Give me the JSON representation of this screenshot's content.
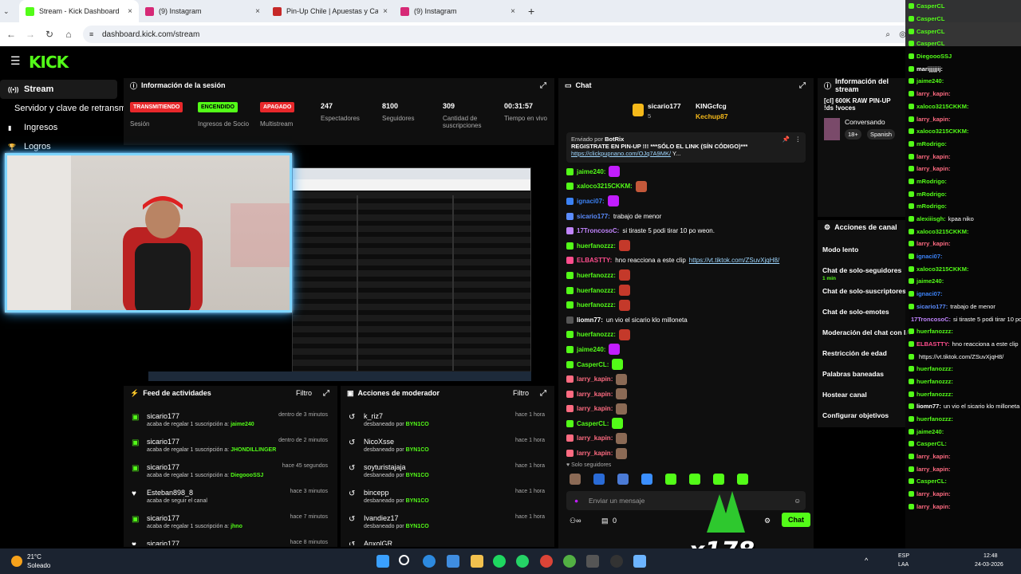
{
  "browser": {
    "tabs": [
      {
        "label": "Stream - Kick Dashboard",
        "color": "#53fc18"
      },
      {
        "label": "(9) Instagram",
        "color": "#d62976"
      },
      {
        "label": "Pin-Up Chile | Apuestas y Casin",
        "color": "#c62828"
      },
      {
        "label": "(9) Instagram",
        "color": "#d62976"
      }
    ],
    "url": "dashboard.kick.com/stream"
  },
  "header": {
    "logo": "KICK"
  },
  "sidebar": [
    {
      "label": "Stream",
      "icon": "radio-icon"
    },
    {
      "label": "Servidor y clave de retransm",
      "icon": "key-icon"
    },
    {
      "label": "Ingresos",
      "icon": "chart-icon"
    },
    {
      "label": "Logros",
      "icon": "trophy-icon"
    }
  ],
  "session": {
    "title": "Información de la sesión",
    "items": [
      {
        "pill": "TRANSMITIENDO",
        "pill_color": "#e8282b",
        "label": "Sesión"
      },
      {
        "pill": "ENCENDIDO",
        "pill_color": "#53fc18",
        "label": "Ingresos de Socio"
      },
      {
        "pill": "APAGADO",
        "pill_color": "#e8282b",
        "label": "Multistream"
      },
      {
        "value": "247",
        "label": "Espectadores"
      },
      {
        "value": "8100",
        "label": "Seguidores"
      },
      {
        "value": "309",
        "label": "Cantidad de suscripciones"
      },
      {
        "value": "00:31:57",
        "label": "Tiempo en vivo"
      }
    ]
  },
  "feed": {
    "title": "Feed de actividades",
    "filter": "Filtro",
    "rows": [
      {
        "name": "sicario177",
        "pre": "acaba de regalar 1 suscripción a:",
        "target": "jaime240",
        "time": "dentro de 3 minutos"
      },
      {
        "name": "sicario177",
        "pre": "acaba de regalar 1 suscripción a:",
        "target": "JHONDILLINGER",
        "time": "dentro de 2 minutos"
      },
      {
        "name": "sicario177",
        "pre": "acaba de regalar 1 suscripción a:",
        "target": "DiegoooSSJ",
        "time": "hace 45 segundos"
      },
      {
        "name": "Esteban898_8",
        "pre": "acaba de seguir el canal",
        "target": "",
        "time": "hace 3 minutos"
      },
      {
        "name": "sicario177",
        "pre": "acaba de regalar 1 suscripción a:",
        "target": "jhno",
        "time": "hace 7 minutos"
      },
      {
        "name": "sicario177",
        "pre": "",
        "target": "",
        "time": "hace 8 minutos"
      }
    ]
  },
  "mod": {
    "title": "Acciones de moderador",
    "filter": "Filtro",
    "rows": [
      {
        "name": "k_riz7",
        "action": "desbaneado por",
        "by": "BYN1CO",
        "time": "hace 1 hora"
      },
      {
        "name": "NicoXsse",
        "action": "desbaneado por",
        "by": "BYN1CO",
        "time": "hace 1 hora"
      },
      {
        "name": "soyturistajaja",
        "action": "desbaneado por",
        "by": "BYN1CO",
        "time": "hace 1 hora"
      },
      {
        "name": "bincepp",
        "action": "desbaneado por",
        "by": "BYN1CO",
        "time": "hace 1 hora"
      },
      {
        "name": "Ivandiez17",
        "action": "desbaneado por",
        "by": "BYN1CO",
        "time": "hace 1 hora"
      },
      {
        "name": "AnxolGR",
        "action": "",
        "by": "",
        "time": ""
      }
    ]
  },
  "chat": {
    "title": "Chat",
    "top": {
      "user1": "sicario177",
      "count": "5",
      "user2": "KINGcfcg",
      "user3": "Kechup87"
    },
    "pinned": {
      "by": "Enviado por",
      "bot": "BotRix",
      "text": "REGISTRATE EN PIN-UP",
      "text2": "!!! ***SÓLO EL LINK (SÍN CÓDIGO)***",
      "link": "https://clickpupnano.com/OJq7A9MK/",
      "tail": "Y..."
    },
    "messages": [
      {
        "user": "jaime240:",
        "color": "#53fc18",
        "text": "",
        "emote": "#c21dff"
      },
      {
        "user": "xaloco3215CKKM:",
        "color": "#53fc18",
        "text": "",
        "emote": "#c4583a"
      },
      {
        "user": "ignaci07:",
        "color": "#3b82f6",
        "text": "",
        "emote": "#c21dff"
      },
      {
        "user": "sicario177:",
        "color": "#5b8cff",
        "text": "trabajo de menor",
        "emote": ""
      },
      {
        "user": "17TroncosoC:",
        "color": "#c084fc",
        "text": "si tiraste 5 podi tirar 10 po weon.",
        "emote": ""
      },
      {
        "user": "huerfanozzz:",
        "color": "#53fc18",
        "text": "",
        "emote": "#c4392a"
      },
      {
        "user": "ELBASTTY:",
        "color": "#ff4d8d",
        "text": "hno reacciona a este clip",
        "link": "https://vt.tiktok.com/ZSuvXjqH8/",
        "emote": ""
      },
      {
        "user": "huerfanozzz:",
        "color": "#53fc18",
        "text": "",
        "emote": "#c4392a"
      },
      {
        "user": "huerfanozzz:",
        "color": "#53fc18",
        "text": "",
        "emote": "#c4392a"
      },
      {
        "user": "huerfanozzz:",
        "color": "#53fc18",
        "text": "",
        "emote": "#c4392a"
      },
      {
        "user": "liomn77:",
        "color": "#ffffff",
        "text": "un vio el sicario klo milloneta",
        "emote": ""
      },
      {
        "user": "huerfanozzz:",
        "color": "#53fc18",
        "text": "",
        "emote": "#c4392a"
      },
      {
        "user": "jaime240:",
        "color": "#53fc18",
        "text": "",
        "emote": "#c21dff"
      },
      {
        "user": "CasperCL:",
        "color": "#53fc18",
        "text": "",
        "emote": "#53fc18"
      },
      {
        "user": "larry_kapin:",
        "color": "#ff6b81",
        "text": "",
        "emote": "#8b6a55"
      },
      {
        "user": "larry_kapin:",
        "color": "#ff6b81",
        "text": "",
        "emote": "#8b6a55"
      },
      {
        "user": "larry_kapin:",
        "color": "#ff6b81",
        "text": "",
        "emote": "#8b6a55"
      },
      {
        "user": "CasperCL:",
        "color": "#53fc18",
        "text": "",
        "emote": "#53fc18"
      },
      {
        "user": "larry_kapin:",
        "color": "#ff6b81",
        "text": "",
        "emote": "#8b6a55"
      },
      {
        "user": "larry_kapin:",
        "color": "#ff6b81",
        "text": "",
        "emote": "#8b6a55"
      }
    ],
    "mode": "Solo seguidores",
    "placeholder": "Enviar un mensaje",
    "count": "0",
    "send": "Chat"
  },
  "streaminfo": {
    "title": "Información del stream",
    "line1": "[cl] 600K RAW PIN-UP",
    "line2": "!ds !voces",
    "category": "Conversando",
    "tags": [
      "18+",
      "Spanish"
    ]
  },
  "channel_actions": {
    "title": "Acciones de canal",
    "items": [
      "Modo lento",
      "Chat de solo-seguidores",
      "Chat de solo-suscriptores",
      "Chat de solo-emotes",
      "Moderación del chat con IA",
      "Restricción de edad",
      "Palabras baneadas",
      "Hostear canal",
      "Configurar objetivos"
    ],
    "sub": "1 min"
  },
  "overlay": [
    {
      "u": "CasperCL",
      "c": "#53fc18",
      "t": ""
    },
    {
      "u": "CasperCL",
      "c": "#53fc18",
      "t": ""
    },
    {
      "u": "CasperCL",
      "c": "#53fc18",
      "t": ""
    },
    {
      "u": "CasperCL",
      "c": "#53fc18",
      "t": ""
    },
    {
      "u": "DiegoooSSJ",
      "c": "#53fc18",
      "t": ""
    },
    {
      "u": "marijjjjjij:",
      "c": "#ffffff",
      "t": ""
    },
    {
      "u": "jaime240:",
      "c": "#53fc18",
      "t": ""
    },
    {
      "u": "larry_kapin:",
      "c": "#ff6b81",
      "t": ""
    },
    {
      "u": "xaloco3215CKKM:",
      "c": "#53fc18",
      "t": ""
    },
    {
      "u": "larry_kapin:",
      "c": "#ff6b81",
      "t": ""
    },
    {
      "u": "xaloco3215CKKM:",
      "c": "#53fc18",
      "t": ""
    },
    {
      "u": "mRodrigo:",
      "c": "#53fc18",
      "t": ""
    },
    {
      "u": "larry_kapin:",
      "c": "#ff6b81",
      "t": ""
    },
    {
      "u": "larry_kapin:",
      "c": "#ff6b81",
      "t": ""
    },
    {
      "u": "mRodrigo:",
      "c": "#53fc18",
      "t": ""
    },
    {
      "u": "mRodrigo:",
      "c": "#53fc18",
      "t": ""
    },
    {
      "u": "mRodrigo:",
      "c": "#53fc18",
      "t": ""
    },
    {
      "u": "alexiiisgh:",
      "c": "#53fc18",
      "t": "kpaa niko"
    },
    {
      "u": "xaloco3215CKKM:",
      "c": "#53fc18",
      "t": ""
    },
    {
      "u": "larry_kapin:",
      "c": "#ff6b81",
      "t": ""
    },
    {
      "u": "ignaci07:",
      "c": "#3b82f6",
      "t": ""
    },
    {
      "u": "xaloco3215CKKM:",
      "c": "#53fc18",
      "t": ""
    },
    {
      "u": "jaime240:",
      "c": "#53fc18",
      "t": ""
    },
    {
      "u": "ignaci07:",
      "c": "#3b82f6",
      "t": ""
    },
    {
      "u": "sicario177:",
      "c": "#5b8cff",
      "t": "trabajo de menor"
    },
    {
      "u": "17TroncosoC:",
      "c": "#c084fc",
      "t": "si tiraste 5 podi tirar 10 po weon."
    },
    {
      "u": "huerfanozzz:",
      "c": "#53fc18",
      "t": ""
    },
    {
      "u": "ELBASTTY:",
      "c": "#ff4d8d",
      "t": "hno reacciona a este clip"
    },
    {
      "u": "",
      "c": "#9fd7ff",
      "t": "https://vt.tiktok.com/ZSuvXjqH8/"
    },
    {
      "u": "huerfanozzz:",
      "c": "#53fc18",
      "t": ""
    },
    {
      "u": "huerfanozzz:",
      "c": "#53fc18",
      "t": ""
    },
    {
      "u": "huerfanozzz:",
      "c": "#53fc18",
      "t": ""
    },
    {
      "u": "liomn77:",
      "c": "#ffffff",
      "t": "un vio el sicario klo milloneta"
    },
    {
      "u": "huerfanozzz:",
      "c": "#53fc18",
      "t": ""
    },
    {
      "u": "jaime240:",
      "c": "#53fc18",
      "t": ""
    },
    {
      "u": "CasperCL:",
      "c": "#53fc18",
      "t": ""
    },
    {
      "u": "larry_kapin:",
      "c": "#ff6b81",
      "t": ""
    },
    {
      "u": "larry_kapin:",
      "c": "#ff6b81",
      "t": ""
    },
    {
      "u": "CasperCL:",
      "c": "#53fc18",
      "t": ""
    },
    {
      "u": "larry_kapin:",
      "c": "#ff6b81",
      "t": ""
    },
    {
      "u": "larry_kapin:",
      "c": "#ff6b81",
      "t": ""
    }
  ],
  "stream_overlay": {
    "tag": "x178"
  },
  "taskbar": {
    "temp": "21°C",
    "weather": "Soleado",
    "lang": "ESP",
    "lang2": "LAA",
    "time": "12:48",
    "date": "24-03-2026"
  }
}
